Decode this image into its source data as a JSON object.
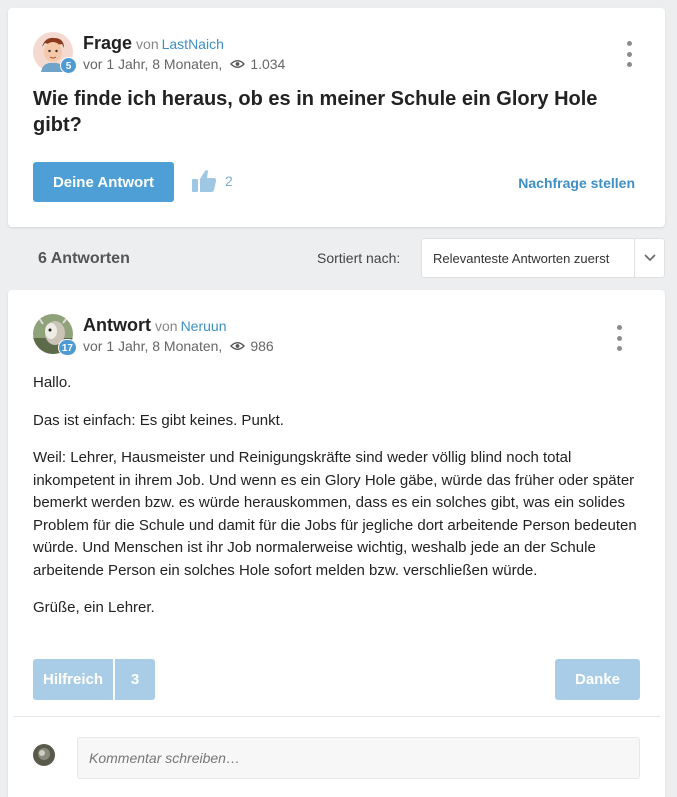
{
  "question": {
    "type_label": "Frage",
    "von": "von",
    "author": "LastNaich",
    "author_level": "5",
    "time": "vor 1 Jahr, 8 Monaten,",
    "views": "1.034",
    "title": "Wie finde ich heraus, ob es in meiner Schule ein Glory Hole gibt?",
    "answer_button": "Deine Antwort",
    "likes": "2",
    "followup_link": "Nachfrage stellen"
  },
  "answers_bar": {
    "count_label": "6 Antworten",
    "sort_label": "Sortiert nach:",
    "sort_value": "Relevanteste Antworten zuerst"
  },
  "answer": {
    "type_label": "Antwort",
    "von": "von",
    "author": "Neruun",
    "author_level": "17",
    "time": "vor 1 Jahr, 8 Monaten,",
    "views": "986",
    "paragraphs": [
      "Hallo.",
      "Das ist einfach: Es gibt keines. Punkt.",
      "Weil: Lehrer, Hausmeister und Reinigungskräfte sind weder völlig blind noch total inkompetent in ihrem Job. Und wenn es ein Glory Hole gäbe, würde das früher oder später bemerkt werden bzw. es würde herauskommen, dass es ein solches gibt, was ein solides Problem für die Schule und damit für die Jobs für jegliche dort arbeitende Person bedeuten würde. Und Menschen ist ihr Job normalerweise wichtig, weshalb jede an der Schule arbeitende Person ein solches Hole sofort melden bzw. verschließen würde.",
      "Grüße, ein Lehrer."
    ],
    "helpful_label": "Hilfreich",
    "helpful_count": "3",
    "thanks_label": "Danke"
  },
  "comment": {
    "placeholder": "Kommentar schreiben…"
  },
  "colors": {
    "accent": "#4e9fd5",
    "accent_light": "#a9cde6",
    "link": "#3f8fc4",
    "background": "#eceeef"
  },
  "icons": [
    "eye-icon",
    "thumbs-up-icon",
    "kebab-menu-icon",
    "chevron-down-icon",
    "user-avatar-icon"
  ]
}
